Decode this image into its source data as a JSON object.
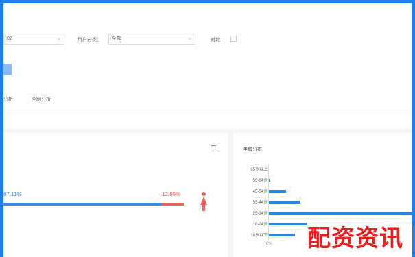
{
  "filters": {
    "first_select_value": "02",
    "user_type_label": "用户分类：",
    "user_type_value": "全部",
    "compare_label": "对比"
  },
  "tabs": [
    {
      "label": "分析"
    },
    {
      "label": "全网分析"
    }
  ],
  "gender": {
    "male_pct": "87.11%",
    "female_pct": "12.89%",
    "male_fraction": 0.8711,
    "colors": {
      "male": "#3b8fe0",
      "female": "#e8615a"
    }
  },
  "age": {
    "title": "年龄分布",
    "labels": [
      "65岁以上",
      "55-64岁",
      "45-54岁",
      "35-44岁",
      "25-34岁",
      "18-24岁",
      "18岁以下"
    ],
    "values": [
      0,
      0.01,
      0.12,
      0.22,
      1.0,
      1.0,
      0.18
    ],
    "axis_ticks": [
      "0%",
      "1"
    ]
  },
  "watermark": "配资资讯"
}
